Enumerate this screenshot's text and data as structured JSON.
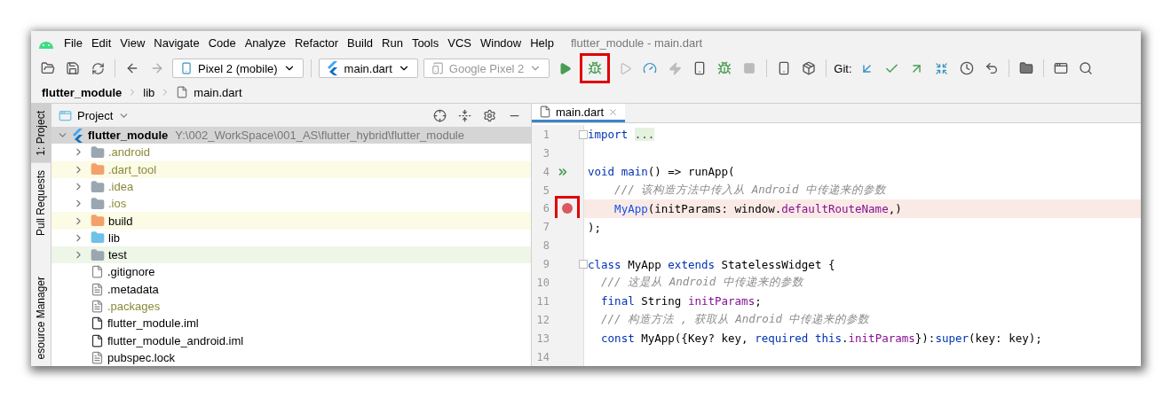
{
  "window": {
    "title": "flutter_module - main.dart"
  },
  "menu": [
    "File",
    "Edit",
    "View",
    "Navigate",
    "Code",
    "Analyze",
    "Refactor",
    "Build",
    "Run",
    "Tools",
    "VCS",
    "Window",
    "Help"
  ],
  "toolbar": {
    "device": "Pixel 2 (mobile)",
    "config": "main.dart",
    "target": {
      "label": "Google Pixel 2",
      "disabled": true
    },
    "git_label": "Git:"
  },
  "breadcrumb": [
    "flutter_module",
    "lib",
    "main.dart"
  ],
  "side_tabs": [
    {
      "label": "1: Project",
      "selected": true
    },
    {
      "label": "Pull Requests",
      "selected": false
    },
    {
      "label": "esource Manager",
      "selected": false
    }
  ],
  "project": {
    "title": "Project",
    "root": {
      "name": "flutter_module",
      "path": "Y:\\002_WorkSpace\\001_AS\\flutter_hybrid\\flutter_module",
      "expanded": true,
      "selected": true,
      "children": [
        {
          "name": ".android",
          "kind": "folder-android",
          "expanded": false,
          "ignored": true
        },
        {
          "name": ".dart_tool",
          "kind": "folder-excluded",
          "expanded": false,
          "ignored": true,
          "color": "#fbfbe6"
        },
        {
          "name": ".idea",
          "kind": "folder-idea",
          "expanded": false,
          "ignored": true
        },
        {
          "name": ".ios",
          "kind": "folder-android",
          "expanded": false,
          "ignored": true
        },
        {
          "name": "build",
          "kind": "folder-build",
          "expanded": false,
          "ignored": false,
          "color": "#fbfbe6"
        },
        {
          "name": "lib",
          "kind": "folder-source",
          "expanded": false,
          "ignored": false
        },
        {
          "name": "test",
          "kind": "folder-test",
          "expanded": false,
          "ignored": false,
          "color": "#eef6e8"
        },
        {
          "name": ".gitignore",
          "kind": "file-ignore",
          "ignored": false
        },
        {
          "name": ".metadata",
          "kind": "file-text",
          "ignored": false
        },
        {
          "name": ".packages",
          "kind": "file-text",
          "ignored": true
        },
        {
          "name": "flutter_module.iml",
          "kind": "file-iml",
          "ignored": false
        },
        {
          "name": "flutter_module_android.iml",
          "kind": "file-iml",
          "ignored": false
        },
        {
          "name": "pubspec.lock",
          "kind": "file-text",
          "ignored": false
        }
      ]
    }
  },
  "editor": {
    "tab": {
      "label": "main.dart",
      "selected": true
    },
    "lines": [
      {
        "number": "1",
        "fold": true,
        "segments": [
          {
            "kind": "kw",
            "text": "import "
          },
          {
            "kind": "folded",
            "text": "..."
          }
        ]
      },
      {
        "number": "3"
      },
      {
        "number": "4",
        "run": true,
        "segments": [
          {
            "kind": "kw",
            "text": "void "
          },
          {
            "kind": "kw",
            "text": "main"
          },
          {
            "kind": "plain",
            "text": "() => runApp("
          }
        ]
      },
      {
        "number": "5",
        "segments": [
          {
            "kind": "comment",
            "text": "    /// 该构造方法中传入从 Android 中传递来的参数"
          }
        ]
      },
      {
        "number": "6",
        "breakpoint": true,
        "segments": [
          {
            "kind": "type",
            "text": "    MyApp"
          },
          {
            "kind": "plain",
            "text": "(initParams: window."
          },
          {
            "kind": "field",
            "text": "defaultRouteName"
          },
          {
            "kind": "plain",
            "text": ",)"
          }
        ]
      },
      {
        "number": "7",
        "segments": [
          {
            "kind": "plain",
            "text": ");"
          }
        ]
      },
      {
        "number": "8"
      },
      {
        "number": "9",
        "fold": true,
        "segments": [
          {
            "kind": "kw",
            "text": "class"
          },
          {
            "kind": "plain",
            "text": " MyApp "
          },
          {
            "kind": "kw",
            "text": "extends"
          },
          {
            "kind": "plain",
            "text": " StatelessWidget {"
          }
        ]
      },
      {
        "number": "10",
        "segments": [
          {
            "kind": "comment",
            "text": "  /// 这是从 Android 中传递来的参数"
          }
        ]
      },
      {
        "number": "11",
        "segments": [
          {
            "kind": "kw",
            "text": "  final"
          },
          {
            "kind": "plain",
            "text": " String "
          },
          {
            "kind": "field",
            "text": "initParams"
          },
          {
            "kind": "plain",
            "text": ";"
          }
        ]
      },
      {
        "number": "12",
        "segments": [
          {
            "kind": "comment",
            "text": "  /// 构造方法 , 获取从 Android 中传递来的参数"
          }
        ]
      },
      {
        "number": "13",
        "segments": [
          {
            "kind": "kw",
            "text": "  const"
          },
          {
            "kind": "plain",
            "text": " MyApp({Key? key, "
          },
          {
            "kind": "kw",
            "text": "required this"
          },
          {
            "kind": "plain",
            "text": "."
          },
          {
            "kind": "field",
            "text": "initParams"
          },
          {
            "kind": "plain",
            "text": "}):"
          },
          {
            "kind": "kw",
            "text": "super"
          },
          {
            "kind": "plain",
            "text": "(key: key);"
          }
        ]
      },
      {
        "number": "14"
      }
    ]
  }
}
